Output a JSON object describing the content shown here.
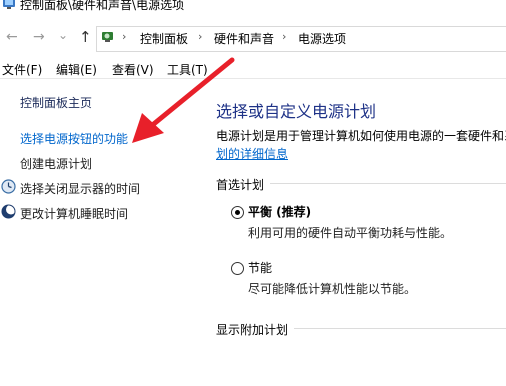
{
  "window": {
    "title": "控制面板\\硬件和声音\\电源选项"
  },
  "nav": {
    "back_icon": "←",
    "forward_icon": "→",
    "dropdown_icon": "⌄",
    "up_icon": "↑"
  },
  "address": {
    "crumbs": [
      "控制面板",
      "硬件和声音",
      "电源选项"
    ],
    "separator": "›"
  },
  "menu": {
    "file": "文件(F)",
    "edit": "编辑(E)",
    "view": "查看(V)",
    "tools": "工具(T)"
  },
  "sidebar": {
    "home": "控制面板主页",
    "items": [
      {
        "label": "选择电源按钮的功能",
        "icon": "none"
      },
      {
        "label": "创建电源计划",
        "icon": "none"
      },
      {
        "label": "选择关闭显示器的时间",
        "icon": "clock-icon"
      },
      {
        "label": "更改计算机睡眠时间",
        "icon": "moon-icon"
      }
    ]
  },
  "main": {
    "title": "选择或自定义电源计划",
    "description": "电源计划是用于管理计算机如何使用电源的一套硬件和系",
    "link": "划的详细信息",
    "preferred_group": "首选计划",
    "plans": [
      {
        "name": "平衡 (推荐)",
        "description": "利用可用的硬件自动平衡功耗与性能。",
        "selected": true
      },
      {
        "name": "节能",
        "description": "尽可能降低计算机性能以节能。",
        "selected": false
      }
    ],
    "additional_group": "显示附加计划"
  },
  "colors": {
    "accent_link": "#0066cc",
    "title_blue": "#1e3287",
    "arrow_red": "#e8202a"
  }
}
